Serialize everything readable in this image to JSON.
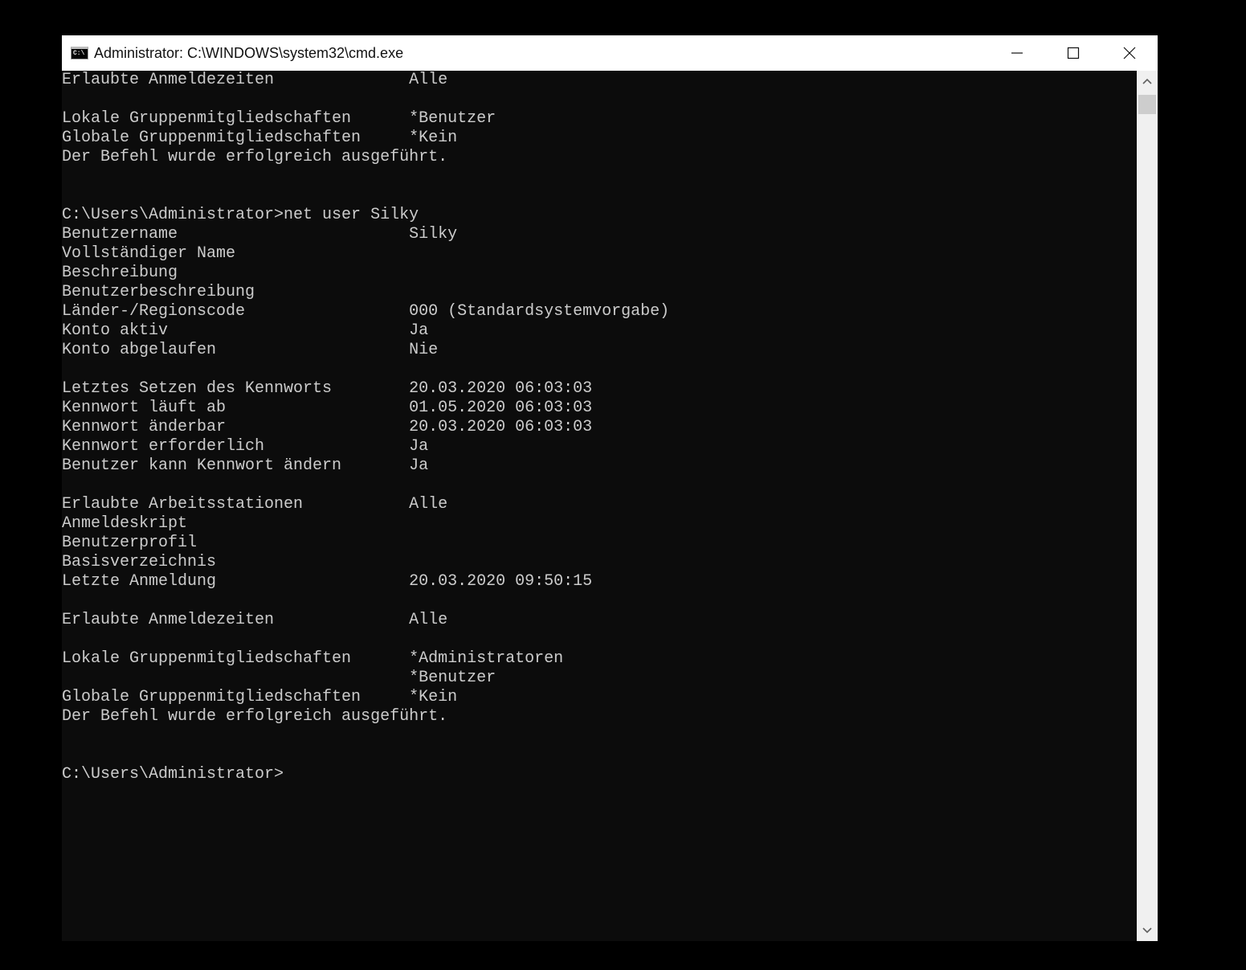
{
  "window": {
    "icon_text": "C:\\",
    "title": "Administrator: C:\\WINDOWS\\system32\\cmd.exe"
  },
  "icons": {
    "app": "cmd-icon",
    "minimize": "minimize-icon",
    "maximize": "maximize-icon",
    "close": "close-icon",
    "scroll_up": "chevron-up-icon",
    "scroll_down": "chevron-down-icon"
  },
  "console": {
    "lines": [
      "Erlaubte Anmeldezeiten              Alle",
      "",
      "Lokale Gruppenmitgliedschaften      *Benutzer",
      "Globale Gruppenmitgliedschaften     *Kein",
      "Der Befehl wurde erfolgreich ausgeführt.",
      "",
      "",
      "C:\\Users\\Administrator>net user Silky",
      "Benutzername                        Silky",
      "Vollständiger Name",
      "Beschreibung",
      "Benutzerbeschreibung",
      "Länder-/Regionscode                 000 (Standardsystemvorgabe)",
      "Konto aktiv                         Ja",
      "Konto abgelaufen                    Nie",
      "",
      "Letztes Setzen des Kennworts        20.03.2020 06:03:03",
      "Kennwort läuft ab                   01.05.2020 06:03:03",
      "Kennwort änderbar                   20.03.2020 06:03:03",
      "Kennwort erforderlich               Ja",
      "Benutzer kann Kennwort ändern       Ja",
      "",
      "Erlaubte Arbeitsstationen           Alle",
      "Anmeldeskript",
      "Benutzerprofil",
      "Basisverzeichnis",
      "Letzte Anmeldung                    20.03.2020 09:50:15",
      "",
      "Erlaubte Anmeldezeiten              Alle",
      "",
      "Lokale Gruppenmitgliedschaften      *Administratoren",
      "                                    *Benutzer",
      "Globale Gruppenmitgliedschaften     *Kein",
      "Der Befehl wurde erfolgreich ausgeführt.",
      "",
      "",
      "C:\\Users\\Administrator>"
    ]
  }
}
